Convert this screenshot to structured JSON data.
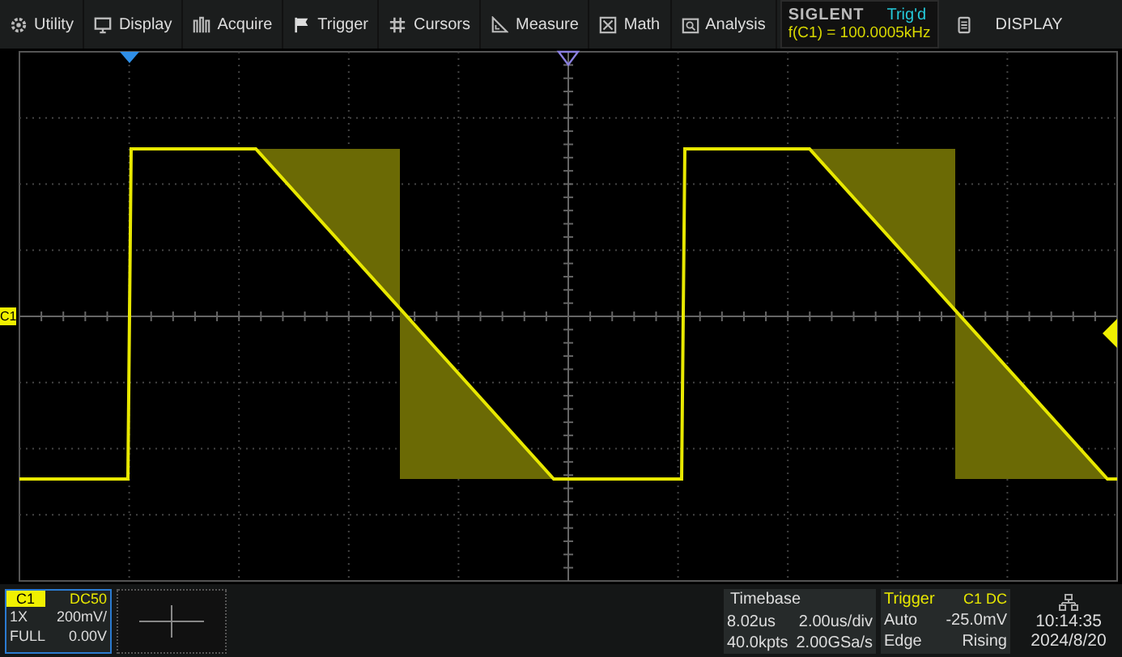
{
  "menu": [
    {
      "label": "Utility"
    },
    {
      "label": "Display"
    },
    {
      "label": "Acquire"
    },
    {
      "label": "Trigger"
    },
    {
      "label": "Cursors"
    },
    {
      "label": "Measure"
    },
    {
      "label": "Math"
    },
    {
      "label": "Analysis"
    }
  ],
  "status": {
    "brand": "SIGLENT",
    "trigger_state": "Trig'd",
    "frequency": "f(C1) = 100.0005kHz"
  },
  "display_button": {
    "label": "DISPLAY"
  },
  "screen": {
    "channel_marker": "C1"
  },
  "channel": {
    "name": "C1",
    "coupling": "DC50",
    "probe": "1X",
    "scale": "200mV/",
    "bandwidth": "FULL",
    "offset": "0.00V",
    "selected": true
  },
  "timebase": {
    "title": "Timebase",
    "delay": "8.02us",
    "scale": "2.00us/div",
    "memory": "40.0kpts",
    "sample_rate": "2.00GSa/s"
  },
  "trigger": {
    "title": "Trigger",
    "source": "C1 DC",
    "mode": "Auto",
    "level": "-25.0mV",
    "type": "Edge",
    "slope": "Rising"
  },
  "clock": {
    "time": "10:14:35",
    "date": "2024/8/20"
  }
}
